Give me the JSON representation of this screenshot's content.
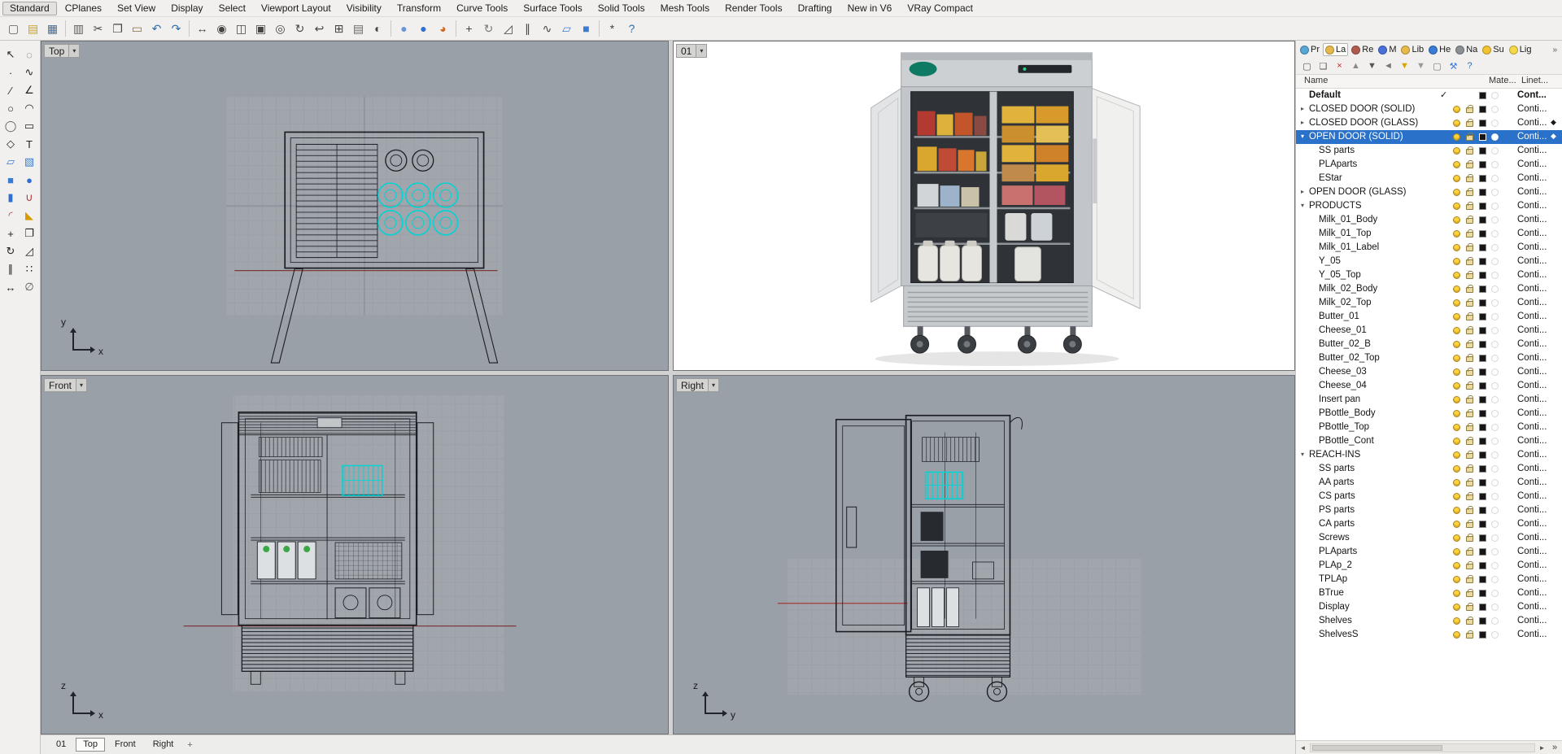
{
  "glyphs": {
    "dropdown": "▾",
    "collapsed": "▸",
    "expanded": "▾",
    "check": "✓",
    "diamond": "◆",
    "scroll_left": "◄",
    "scroll_right": "►",
    "more": "»",
    "new_tab": "+"
  },
  "colors": {
    "selection": "#2a71c9",
    "viewport_background": "#9aa0a8",
    "highlight_cyan": "#00d4d4",
    "bulb_yellow": "#ffd23e"
  },
  "menu": {
    "active": "Standard",
    "tabs": [
      "Standard",
      "CPlanes",
      "Set View",
      "Display",
      "Select",
      "Viewport Layout",
      "Visibility",
      "Transform",
      "Curve Tools",
      "Surface Tools",
      "Solid Tools",
      "Mesh Tools",
      "Render Tools",
      "Drafting",
      "New in V6",
      "VRay Compact"
    ]
  },
  "toolbar": {
    "groups": [
      [
        {
          "name": "new-file-icon",
          "glyph": "▢",
          "color": "#5a5a5a"
        },
        {
          "name": "open-file-icon",
          "glyph": "▤",
          "color": "#c9a227"
        },
        {
          "name": "save-icon",
          "glyph": "▦",
          "color": "#3a6ea5"
        }
      ],
      [
        {
          "name": "print-icon",
          "glyph": "▥",
          "color": "#5a5a5a"
        },
        {
          "name": "cut-icon",
          "glyph": "✂",
          "color": "#444444"
        },
        {
          "name": "copy-icon",
          "glyph": "❐",
          "color": "#444444"
        },
        {
          "name": "paste-icon",
          "glyph": "▭",
          "color": "#8a6d3b"
        },
        {
          "name": "undo-icon",
          "glyph": "↶",
          "color": "#2e6da4"
        },
        {
          "name": "redo-icon",
          "glyph": "↷",
          "color": "#2e6da4"
        }
      ],
      [
        {
          "name": "pan-view-icon",
          "glyph": "↔",
          "color": "#444444"
        },
        {
          "name": "zoom-dynamic-icon",
          "glyph": "◉",
          "color": "#444444"
        },
        {
          "name": "zoom-window-icon",
          "glyph": "◫",
          "color": "#444444"
        },
        {
          "name": "zoom-extents-icon",
          "glyph": "▣",
          "color": "#444444"
        },
        {
          "name": "zoom-selected-icon",
          "glyph": "◎",
          "color": "#444444"
        },
        {
          "name": "rotate-view-icon",
          "glyph": "↻",
          "color": "#444444"
        },
        {
          "name": "previous-view-icon",
          "glyph": "↩",
          "color": "#444444"
        },
        {
          "name": "four-viewports-icon",
          "glyph": "⊞",
          "color": "#444444"
        },
        {
          "name": "named-views-icon",
          "glyph": "▤",
          "color": "#666666"
        },
        {
          "name": "display-mode-icon",
          "glyph": "◐",
          "color": "#444444"
        }
      ],
      [
        {
          "name": "shaded-display-icon",
          "glyph": "●",
          "color": "#6f94d6"
        },
        {
          "name": "render-icon",
          "glyph": "●",
          "color": "#2f6fce"
        },
        {
          "name": "render-preview-icon",
          "glyph": "◕",
          "color": "#cc6a1f"
        }
      ],
      [
        {
          "name": "move-icon",
          "glyph": "+",
          "color": "#444444"
        },
        {
          "name": "rotate-icon",
          "glyph": "↻",
          "color": "#777777"
        },
        {
          "name": "scale-icon",
          "glyph": "◿",
          "color": "#444444"
        },
        {
          "name": "mirror-icon",
          "glyph": "∥",
          "color": "#444444"
        },
        {
          "name": "curve-tools-icon",
          "glyph": "∿",
          "color": "#444444"
        },
        {
          "name": "surface-tools-icon",
          "glyph": "▱",
          "color": "#3a7bd5"
        },
        {
          "name": "solid-tools-icon",
          "glyph": "■",
          "color": "#3a7bd5"
        }
      ],
      [
        {
          "name": "options-icon",
          "glyph": "*",
          "color": "#444444"
        },
        {
          "name": "help-icon",
          "glyph": "?",
          "color": "#2e6da4"
        }
      ]
    ]
  },
  "left_toolbar": {
    "icons": [
      {
        "name": "select-arrow-icon",
        "glyph": "↖",
        "color": "#222222"
      },
      {
        "name": "lasso-select-icon",
        "glyph": "◌",
        "color": "#555555"
      },
      {
        "name": "point-icon",
        "glyph": "∙",
        "color": "#222222"
      },
      {
        "name": "control-point-curve-icon",
        "glyph": "∿",
        "color": "#222222"
      },
      {
        "name": "line-icon",
        "glyph": "∕",
        "color": "#222222"
      },
      {
        "name": "polyline-icon",
        "glyph": "∠",
        "color": "#222222"
      },
      {
        "name": "circle-icon",
        "glyph": "○",
        "color": "#222222"
      },
      {
        "name": "arc-icon",
        "glyph": "◠",
        "color": "#222222"
      },
      {
        "name": "ellipse-icon",
        "glyph": "◯",
        "color": "#555555"
      },
      {
        "name": "rectangle-icon",
        "glyph": "▭",
        "color": "#222222"
      },
      {
        "name": "polygon-icon",
        "glyph": "◇",
        "color": "#222222"
      },
      {
        "name": "text-icon",
        "glyph": "T",
        "color": "#222222"
      },
      {
        "name": "surface-icon",
        "glyph": "▱",
        "color": "#3a7bd5"
      },
      {
        "name": "extrude-icon",
        "glyph": "▧",
        "color": "#3a7bd5"
      },
      {
        "name": "box-icon",
        "glyph": "■",
        "color": "#3a7bd5"
      },
      {
        "name": "sphere-icon",
        "glyph": "●",
        "color": "#2f6fce"
      },
      {
        "name": "cylinder-icon",
        "glyph": "▮",
        "color": "#2f6fce"
      },
      {
        "name": "boolean-union-icon",
        "glyph": "∪",
        "color": "#b03030"
      },
      {
        "name": "fillet-icon",
        "glyph": "◜",
        "color": "#b03030"
      },
      {
        "name": "chamfer-icon",
        "glyph": "◣",
        "color": "#d99a00"
      },
      {
        "name": "move-icon",
        "glyph": "+",
        "color": "#222222"
      },
      {
        "name": "copy-object-icon",
        "glyph": "❐",
        "color": "#222222"
      },
      {
        "name": "rotate-icon",
        "glyph": "↻",
        "color": "#222222"
      },
      {
        "name": "scale-icon",
        "glyph": "◿",
        "color": "#222222"
      },
      {
        "name": "mirror-icon",
        "glyph": "∥",
        "color": "#222222"
      },
      {
        "name": "array-icon",
        "glyph": "∷",
        "color": "#222222"
      },
      {
        "name": "dimension-icon",
        "glyph": "↔",
        "color": "#222222"
      },
      {
        "name": "hide-object-icon",
        "glyph": "∅",
        "color": "#555555"
      }
    ]
  },
  "viewports": {
    "top": {
      "title": "Top",
      "axis_v": "y",
      "axis_h": "x"
    },
    "perspective": {
      "title": "01"
    },
    "front": {
      "title": "Front",
      "axis_v": "z",
      "axis_h": "x"
    },
    "right": {
      "title": "Right",
      "axis_v": "z",
      "axis_h": "y"
    }
  },
  "layers_panel": {
    "panel_tabs": [
      {
        "label": "Pr",
        "name": "panel-tab-properties",
        "icon": "properties-icon",
        "color": "#58a6d6"
      },
      {
        "label": "La",
        "name": "panel-tab-layers",
        "icon": "layers-icon",
        "color": "#e8b84b",
        "active": true
      },
      {
        "label": "Re",
        "name": "panel-tab-rendering",
        "icon": "rendering-icon",
        "color": "#b05b4e"
      },
      {
        "label": "M",
        "name": "panel-tab-materials",
        "icon": "materials-icon",
        "color": "#4a6fd9"
      },
      {
        "label": "Lib",
        "name": "panel-tab-libraries",
        "icon": "libraries-icon",
        "color": "#e8b84b"
      },
      {
        "label": "He",
        "name": "panel-tab-help",
        "icon": "help-icon",
        "color": "#3a7bd5"
      },
      {
        "label": "Na",
        "name": "panel-tab-named-views",
        "icon": "named-views-icon",
        "color": "#8a8f94"
      },
      {
        "label": "Su",
        "name": "panel-tab-sun",
        "icon": "sun-icon",
        "color": "#f2c230"
      },
      {
        "label": "Lig",
        "name": "panel-tab-lights",
        "icon": "lights-icon",
        "color": "#f4d84a"
      }
    ],
    "toolbar": [
      {
        "name": "new-layer-icon",
        "glyph": "▢",
        "color": "#555555"
      },
      {
        "name": "new-sublayer-icon",
        "glyph": "❏",
        "color": "#555555"
      },
      {
        "name": "delete-layer-icon",
        "glyph": "×",
        "color": "#cc2222"
      },
      {
        "name": "move-layer-up-icon",
        "glyph": "▲",
        "color": "#8a8a8a"
      },
      {
        "name": "move-layer-down-icon",
        "glyph": "▼",
        "color": "#555555"
      },
      {
        "name": "match-layer-icon",
        "glyph": "◄",
        "color": "#777777"
      },
      {
        "name": "filter-layers-icon",
        "glyph": "▼",
        "color": "#d9a400"
      },
      {
        "name": "layer-state-filter-icon",
        "glyph": "▼",
        "color": "#999999"
      },
      {
        "name": "layer-report-icon",
        "glyph": "▢",
        "color": "#777777"
      },
      {
        "name": "layer-tools-icon",
        "glyph": "⚒",
        "color": "#3a7bd5"
      },
      {
        "name": "help-icon",
        "glyph": "?",
        "color": "#2e6da4"
      }
    ],
    "columns": [
      "Name",
      "Mate...",
      "Linet..."
    ],
    "rows": [
      {
        "name": "Default",
        "indent": 0,
        "bold": true,
        "current": true,
        "linetype": "Cont..."
      },
      {
        "name": "CLOSED DOOR (SOLID)",
        "indent": 0,
        "expand": "collapsed",
        "linetype": "Conti..."
      },
      {
        "name": "CLOSED DOOR (GLASS)",
        "indent": 0,
        "expand": "collapsed",
        "linetype": "Conti...",
        "diamond": true
      },
      {
        "name": "OPEN DOOR (SOLID)",
        "indent": 0,
        "expand": "expanded",
        "selected": true,
        "linetype": "Conti...",
        "diamond": true
      },
      {
        "name": "SS parts",
        "indent": 1,
        "linetype": "Conti..."
      },
      {
        "name": "PLAparts",
        "indent": 1,
        "linetype": "Conti..."
      },
      {
        "name": "EStar",
        "indent": 1,
        "linetype": "Conti..."
      },
      {
        "name": "OPEN DOOR (GLASS)",
        "indent": 0,
        "expand": "collapsed",
        "linetype": "Conti..."
      },
      {
        "name": "PRODUCTS",
        "indent": 0,
        "expand": "expanded",
        "linetype": "Conti..."
      },
      {
        "name": "Milk_01_Body",
        "indent": 1,
        "linetype": "Conti..."
      },
      {
        "name": "Milk_01_Top",
        "indent": 1,
        "linetype": "Conti..."
      },
      {
        "name": "Milk_01_Label",
        "indent": 1,
        "linetype": "Conti..."
      },
      {
        "name": "Y_05",
        "indent": 1,
        "linetype": "Conti..."
      },
      {
        "name": "Y_05_Top",
        "indent": 1,
        "linetype": "Conti..."
      },
      {
        "name": "Milk_02_Body",
        "indent": 1,
        "linetype": "Conti..."
      },
      {
        "name": "Milk_02_Top",
        "indent": 1,
        "linetype": "Conti..."
      },
      {
        "name": "Butter_01",
        "indent": 1,
        "linetype": "Conti..."
      },
      {
        "name": "Cheese_01",
        "indent": 1,
        "linetype": "Conti..."
      },
      {
        "name": "Butter_02_B",
        "indent": 1,
        "linetype": "Conti..."
      },
      {
        "name": "Butter_02_Top",
        "indent": 1,
        "linetype": "Conti..."
      },
      {
        "name": "Cheese_03",
        "indent": 1,
        "linetype": "Conti..."
      },
      {
        "name": "Cheese_04",
        "indent": 1,
        "linetype": "Conti..."
      },
      {
        "name": "Insert pan",
        "indent": 1,
        "linetype": "Conti..."
      },
      {
        "name": "PBottle_Body",
        "indent": 1,
        "linetype": "Conti..."
      },
      {
        "name": "PBottle_Top",
        "indent": 1,
        "linetype": "Conti..."
      },
      {
        "name": "PBottle_Cont",
        "indent": 1,
        "linetype": "Conti..."
      },
      {
        "name": "REACH-INS",
        "indent": 0,
        "expand": "expanded",
        "linetype": "Conti..."
      },
      {
        "name": "SS parts",
        "indent": 1,
        "linetype": "Conti..."
      },
      {
        "name": "AA parts",
        "indent": 1,
        "linetype": "Conti..."
      },
      {
        "name": "CS parts",
        "indent": 1,
        "linetype": "Conti..."
      },
      {
        "name": "PS parts",
        "indent": 1,
        "linetype": "Conti..."
      },
      {
        "name": "CA parts",
        "indent": 1,
        "linetype": "Conti..."
      },
      {
        "name": "Screws",
        "indent": 1,
        "linetype": "Conti..."
      },
      {
        "name": "PLAparts",
        "indent": 1,
        "linetype": "Conti..."
      },
      {
        "name": "PLAp_2",
        "indent": 1,
        "linetype": "Conti..."
      },
      {
        "name": "TPLAp",
        "indent": 1,
        "linetype": "Conti..."
      },
      {
        "name": "BTrue",
        "indent": 1,
        "linetype": "Conti..."
      },
      {
        "name": "Display",
        "indent": 1,
        "linetype": "Conti..."
      },
      {
        "name": "Shelves",
        "indent": 1,
        "linetype": "Conti..."
      },
      {
        "name": "ShelvesS",
        "indent": 1,
        "linetype": "Conti..."
      }
    ]
  },
  "viewport_tabs": {
    "active": "Top",
    "tabs": [
      "01",
      "Top",
      "Front",
      "Right"
    ]
  }
}
